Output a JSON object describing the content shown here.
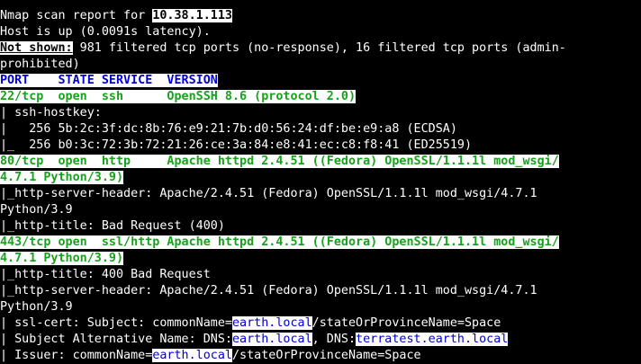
{
  "terminal": {
    "top_partial": "",
    "report_prefix": "Nmap scan report for ",
    "target_ip": "10.38.1.113",
    "host_up": "Host is up (0.0091s latency).",
    "not_shown_label": "Not shown:",
    "not_shown_text_1": " 981 filtered tcp ports (no-response), 16 filtered tcp ports (admin-",
    "not_shown_text_2": "prohibited)",
    "table_header": "PORT    STATE SERVICE  VERSION",
    "ports": [
      {
        "line1": "22/tcp  open  ssh      OpenSSH 8.6 (protocol 2.0)",
        "details": [
          "| ssh-hostkey:",
          "|   256 5b:2c:3f:dc:8b:76:e9:21:7b:d0:56:24:df:be:e9:a8 (ECDSA)",
          "|_  256 b0:3c:72:3b:72:21:26:ce:3a:84:e8:41:ec:c8:f8:41 (ED25519)"
        ]
      },
      {
        "line1": "80/tcp  open  http     Apache httpd 2.4.51 ((Fedora) OpenSSL/1.1.1l mod_wsgi/",
        "line2": "4.7.1 Python/3.9)",
        "details": [
          "|_http-server-header: Apache/2.4.51 (Fedora) OpenSSL/1.1.1l mod_wsgi/4.7.1",
          "Python/3.9",
          "|_http-title: Bad Request (400)"
        ]
      },
      {
        "line1": "443/tcp open  ssl/http Apache httpd 2.4.51 ((Fedora) OpenSSL/1.1.1l mod_wsgi/",
        "line2": "4.7.1 Python/3.9)",
        "details": [
          "|_http-title: 400 Bad Request",
          "|_http-server-header: Apache/2.4.51 (Fedora) OpenSSL/1.1.1l mod_wsgi/4.7.1",
          "Python/3.9"
        ]
      }
    ],
    "ssl_cert": {
      "subject_prefix": "| ssl-cert: Subject: commonName=",
      "subject_cn": "earth.local",
      "subject_suffix": "/stateOrProvinceName=Space",
      "san_prefix": "| Subject Alternative Name: DNS:",
      "san_dns1": "earth.local",
      "san_mid": ", DNS:",
      "san_dns2": "terratest.earth.local",
      "issuer_prefix": "| Issuer: commonName=",
      "issuer_cn": "earth.local",
      "issuer_suffix": "/stateOrProvinceName=Space"
    },
    "colors": {
      "background": "#000000",
      "text": "#ffffff",
      "header": "#0000d8",
      "open_port": "#16a21a",
      "hostname_highlight": "#0000c8"
    }
  }
}
